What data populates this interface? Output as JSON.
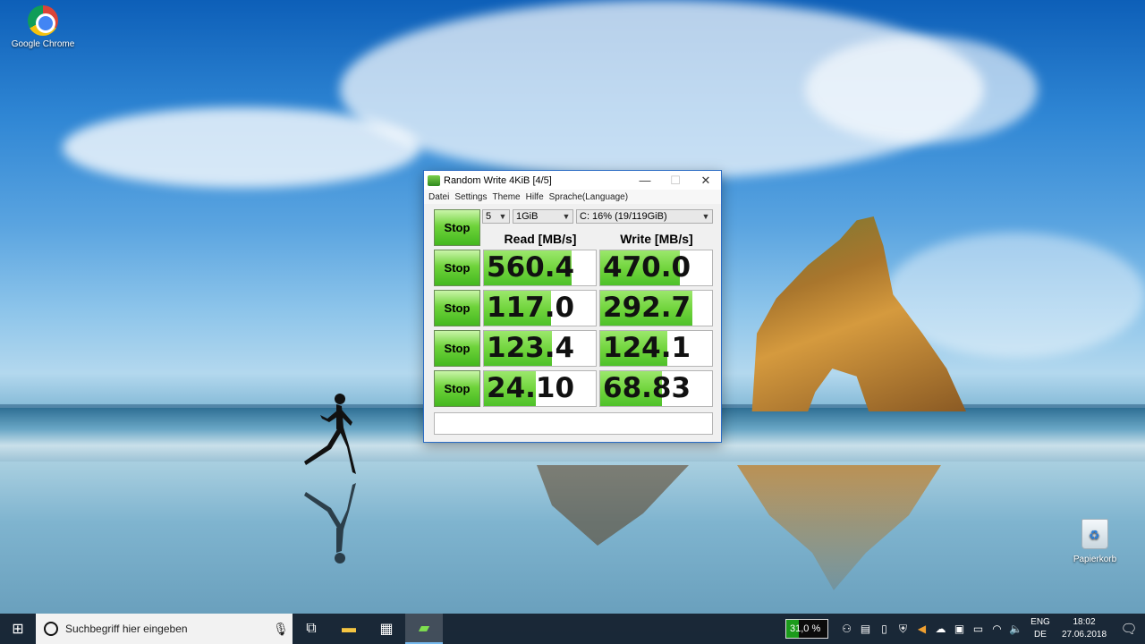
{
  "desktop": {
    "icons": [
      {
        "label": "Google Chrome",
        "icon": "chrome-icon"
      },
      {
        "label": "Papierkorb",
        "icon": "recycle-bin-icon"
      }
    ]
  },
  "window": {
    "title": "Random Write 4KiB [4/5]",
    "controls": {
      "minimize": "—",
      "maximize": "☐",
      "close": "✕"
    },
    "menu": [
      "Datei",
      "Settings",
      "Theme",
      "Hilfe",
      "Sprache(Language)"
    ],
    "selectors": {
      "count": "5",
      "size": "1GiB",
      "drive": "C: 16% (19/119GiB)"
    },
    "all_button_label": "Stop",
    "columns": {
      "read": "Read [MB/s]",
      "write": "Write [MB/s]"
    },
    "rows": [
      {
        "button": "Stop",
        "read": "560.4",
        "write": "470.0",
        "read_fill_pct": 78,
        "write_fill_pct": 71
      },
      {
        "button": "Stop",
        "read": "117.0",
        "write": "292.7",
        "read_fill_pct": 60,
        "write_fill_pct": 82
      },
      {
        "button": "Stop",
        "read": "123.4",
        "write": "124.1",
        "read_fill_pct": 61,
        "write_fill_pct": 60
      },
      {
        "button": "Stop",
        "read": "24.10",
        "write": "68.83",
        "read_fill_pct": 46,
        "write_fill_pct": 55
      }
    ],
    "comment": ""
  },
  "taskbar": {
    "search_placeholder": "Suchbegriff hier eingeben",
    "cpu": "31,0 %",
    "cpu_pct": 31,
    "lang_top": "ENG",
    "lang_bottom": "DE",
    "time": "18:02",
    "date": "27.06.2018"
  }
}
